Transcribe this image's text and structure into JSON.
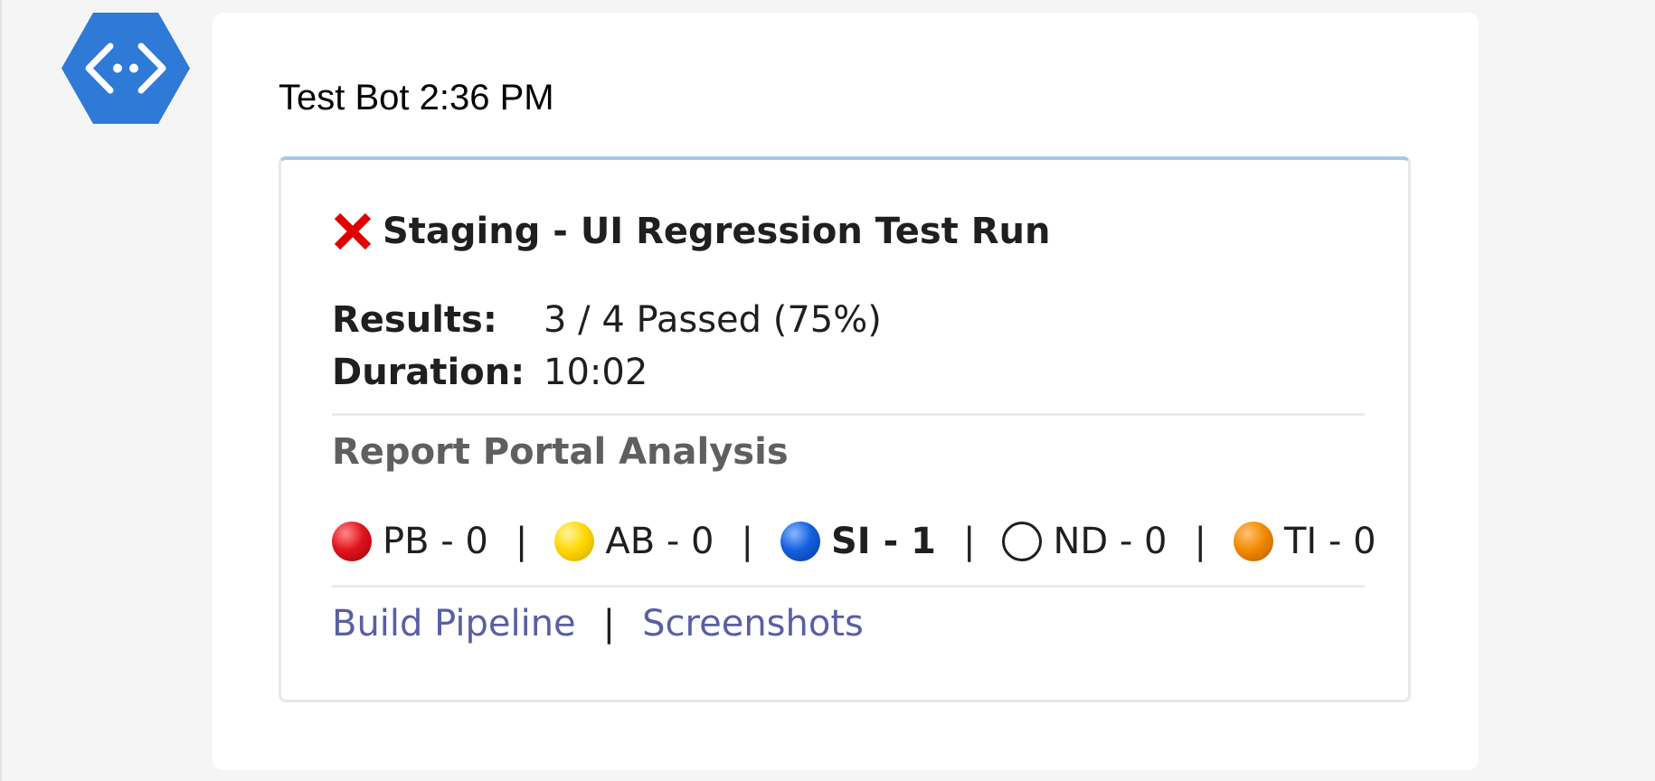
{
  "message": {
    "sender": "Test Bot",
    "time": "2:36 PM"
  },
  "card": {
    "status_icon": "red-x-icon",
    "title": "Staging - UI Regression Test Run",
    "facts": [
      {
        "label": "Results:",
        "value": "3 / 4 Passed (75%)"
      },
      {
        "label": "Duration:",
        "value": "10:02"
      }
    ],
    "section_title": "Report Portal Analysis",
    "analysis": [
      {
        "label": "PB - 0",
        "color": "#e0141e",
        "icon": "red-circle-icon",
        "bold": false
      },
      {
        "label": "AB - 0",
        "color": "#ffd800",
        "icon": "yellow-circle-icon",
        "bold": false
      },
      {
        "label": "SI - 1",
        "color": "#1460e0",
        "icon": "blue-circle-icon",
        "bold": true
      },
      {
        "label": "ND - 0",
        "color": "#ffffff",
        "icon": "white-circle-icon",
        "bold": false
      },
      {
        "label": "TI - 0",
        "color": "#f38a00",
        "icon": "orange-circle-icon",
        "bold": false
      }
    ],
    "separator": "|",
    "links": [
      {
        "label": "Build Pipeline"
      },
      {
        "label": "Screenshots"
      }
    ]
  },
  "colors": {
    "avatar": "#2f7ad6",
    "link": "#5a5fa3",
    "card_top_border": "#a9c7e8",
    "error": "#e00000"
  }
}
